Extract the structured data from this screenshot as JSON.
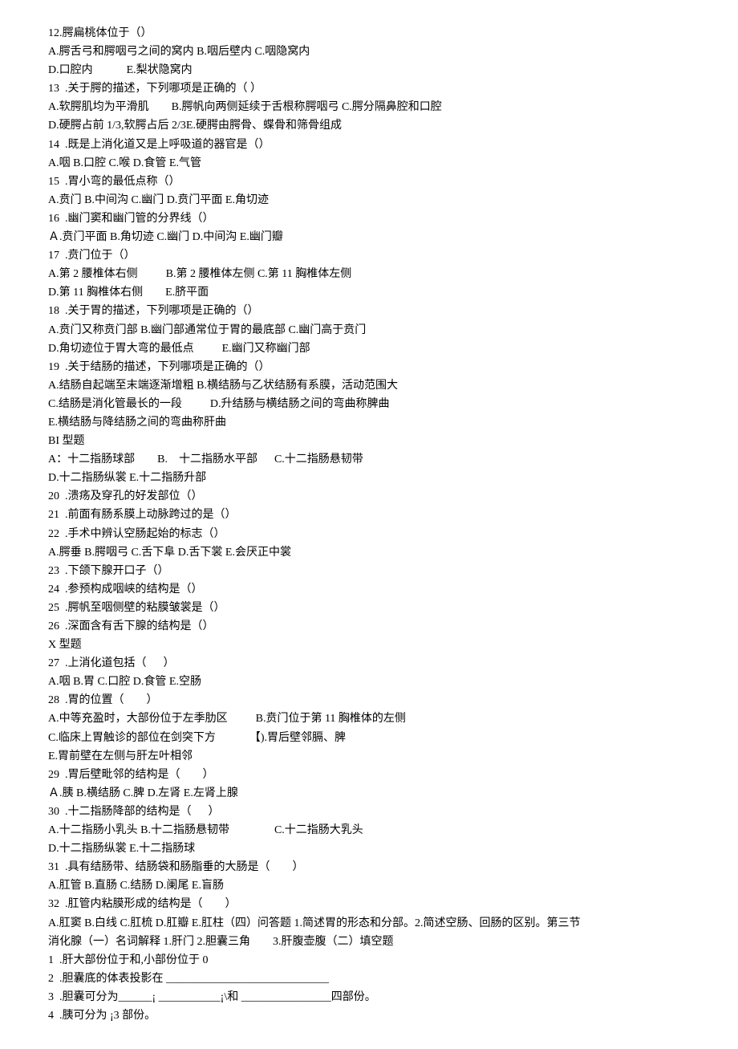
{
  "lines": [
    "12.腭扁桃体位于（）",
    "A.腭舌弓和腭咽弓之间的窝内 B.咽后壁内 C.咽隐窝内",
    "D.口腔内            E.梨状隐窝内",
    "13  .关于腭的描述，下列哪项是正确的（ ）",
    "A.软腭肌均为平滑肌        B.腭帆向两侧延续于舌根称腭咽弓 C.腭分隔鼻腔和口腔",
    "D.硬腭占前 1/3,软腭占后 2/3E.硬腭由腭骨、蝶骨和筛骨组成",
    "14  .既是上消化道又是上呼吸道的器官是（）",
    "A.咽 B.口腔 C.喉 D.食管 E.气管",
    "15  .胃小弯的最低点称（）",
    "A.贲门 B.中间沟 C.幽门 D.贲门平面 E.角切迹",
    "16  .幽门窦和幽门管的分界线（）",
    "Ａ.贲门平面 B.角切迹 C.幽门 D.中间沟 E.幽门瓣",
    "17  .贲门位于（）",
    "A.第 2 腰椎体右侧          B.第 2 腰椎体左侧 C.第 11 胸椎体左侧",
    "D.第 11 胸椎体右侧        E.脐平面",
    "18  .关于胃的描述，下列哪项是正确的（）",
    "A.贲门又称贲门部 B.幽门部通常位于胃的最底部 C.幽门高于贲门",
    "D.角切迹位于胃大弯的最低点          E.幽门又称幽门部",
    "19  .关于结肠的描述，下列哪项是正确的（）",
    "A.结肠自起端至末端逐渐增粗 B.横结肠与乙状结肠有系膜，活动范围大",
    "C.结肠是消化管最长的一段          D.升结肠与横结肠之间的弯曲称脾曲",
    "E.横结肠与降结肠之间的弯曲称肝曲",
    "BI 型题",
    "A：十二指肠球部        B.    十二指肠水平部      C.十二指肠悬韧带",
    "D.十二指肠纵裳 E.十二指肠升部",
    "20  .溃疡及穿孔的好发部位（）",
    "21  .前面有肠系膜上动脉跨过的是（）",
    "22  .手术中辨认空肠起始的标志（）",
    "A.腭垂 B.腭咽弓 C.舌下阜 D.舌下裳 E.会厌正中裳",
    "23  .下颌下腺开口子（）",
    "24  .参预构成咽峡的结构是（）",
    "25  .腭帆至咽侧壁的粘膜皱裳是（）",
    "26  .深面含有舌下腺的结构是（）",
    "X 型题",
    "27  .上消化道包括（      ）",
    "A.咽 B.胃 C.口腔 D.食管 E.空肠",
    "28  .胃的位置（        ）",
    "A.中等充盈时，大部份位于左季肋区          B.贲门位于第 11 胸椎体的左侧",
    "C.临床上胃触诊的部位在剑突下方            【).胃后壁邻膈、脾",
    "E.胃前壁在左侧与肝左叶相邻",
    "29  .胃后壁毗邻的结构是（        ）",
    "Ａ.胰 B.横结肠 C.脾 D.左肾 E.左肾上腺",
    "30  .十二指肠降部的结构是（      ）",
    "A.十二指肠小乳头 B.十二指肠悬韧带                C.十二指肠大乳头",
    "D.十二指肠纵裳 E.十二指肠球",
    "31  .具有结肠带、结肠袋和肠脂垂的大肠是（        ）",
    "A.肛管 B.直肠 C.结肠 D.阑尾 E.盲肠",
    "32  .肛管内粘膜形成的结构是（        ）",
    "A.肛窦 B.白线 C.肛梳 D.肛瓣 E.肛柱（四）问答题 1.简述胃的形态和分部。2.简述空肠、回肠的区别。第三节",
    "消化腺（一）名词解释 1.肝门 2.胆囊三角        3.肝腹壶腹（二）填空题",
    "1  .肝大部份位于和,小部份位于 0",
    "2  .胆囊底的体表投影在 _____________________________",
    "3  .胆囊可分为______¡ ___________¡\\和 ________________四部份。",
    "4  .胰可分为 ¡3 部份。"
  ]
}
